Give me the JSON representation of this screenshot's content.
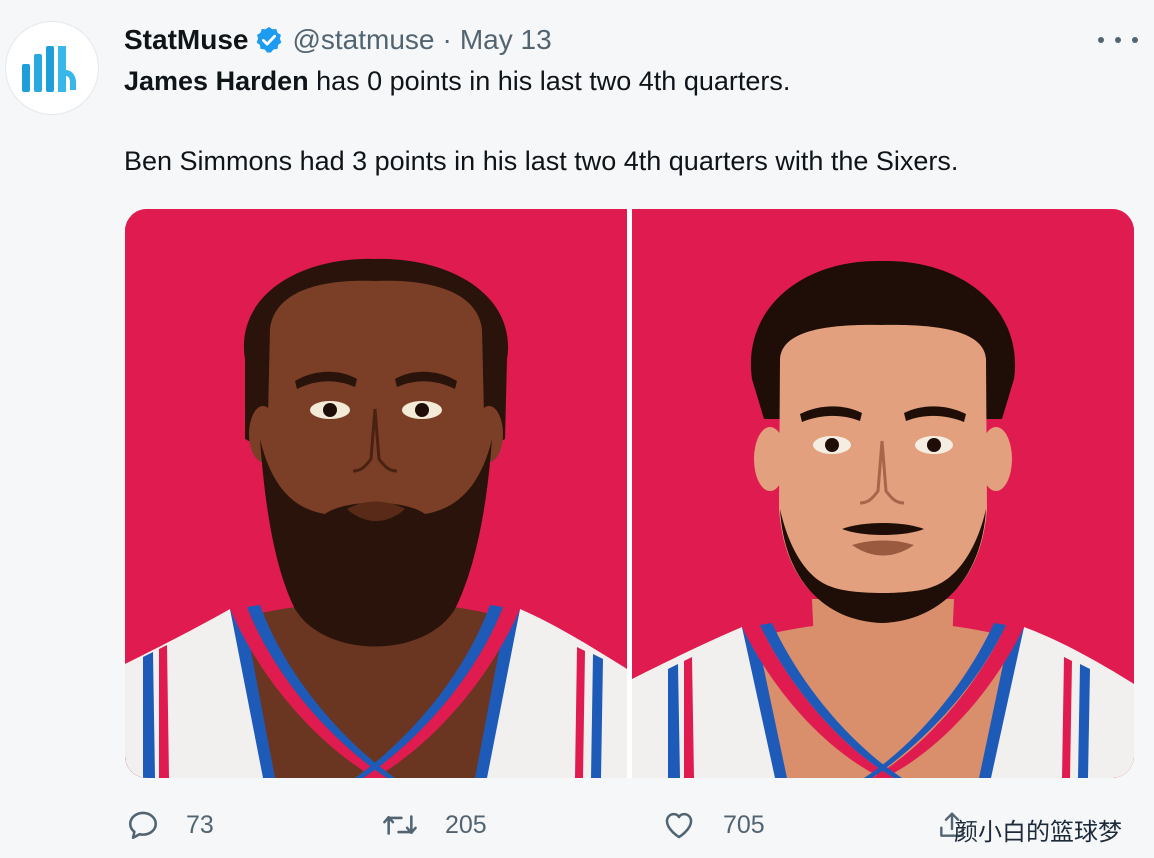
{
  "tweet": {
    "display_name": "StatMuse",
    "handle": "@statmuse",
    "separator": "·",
    "date": "May 13",
    "line1_mention": "James Harden",
    "line1_rest": " has 0 points in his last two 4th quarters.",
    "line2": "Ben Simmons had 3 points in his last two 4th quarters with the Sixers."
  },
  "actions": {
    "replies": "73",
    "retweets": "205",
    "likes": "705"
  },
  "watermark": "颜小白的篮球梦",
  "icons": {
    "avatar": "statmuse-logo-icon",
    "verified": "verified-badge-icon",
    "more": "more-options-icon",
    "reply": "reply-icon",
    "retweet": "retweet-icon",
    "like": "heart-icon",
    "share": "share-icon"
  },
  "colors": {
    "accent": "#1d9bf0",
    "panel_background": "#e01b50",
    "muted_text": "#536471",
    "sixers_blue": "#1e5bb8",
    "sixers_red": "#e01b50"
  }
}
